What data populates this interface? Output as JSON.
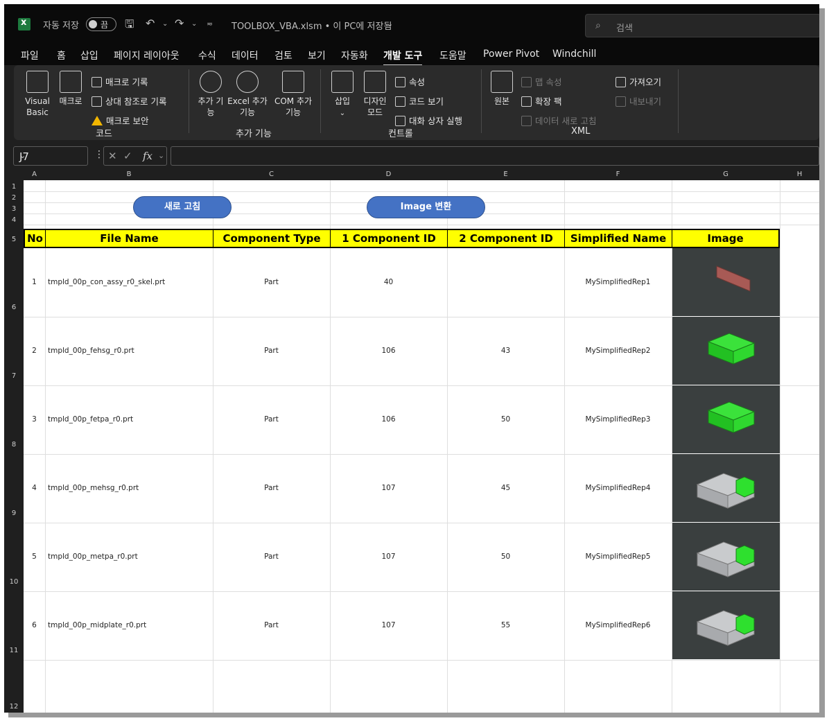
{
  "titlebar": {
    "autosave_label": "자동 저장",
    "autosave_state": "끔",
    "doc_title": "TOOLBOX_VBA.xlsm • 이 PC에 저장됨",
    "search_placeholder": "검색"
  },
  "tabs": [
    "파일",
    "홈",
    "삽입",
    "페이지 레이아웃",
    "수식",
    "데이터",
    "검토",
    "보기",
    "자동화",
    "개발 도구",
    "도움말",
    "Power Pivot",
    "Windchill"
  ],
  "active_tab": "개발 도구",
  "ribbon": {
    "code": {
      "label": "코드",
      "visual_basic": "Visual Basic",
      "macro": "매크로",
      "record_macro": "매크로 기록",
      "relative_ref": "상대 참조로 기록",
      "macro_security": "매크로 보안"
    },
    "addins": {
      "label": "추가 기능",
      "addins_btn": "추가 기능",
      "excel_addins": "Excel 추가 기능",
      "com_addins": "COM 추가 기능"
    },
    "controls": {
      "label": "컨트롤",
      "insert": "삽입",
      "design_mode": "디자인 모드",
      "properties": "속성",
      "view_code": "코드 보기",
      "run_dialog": "대화 상자 실행"
    },
    "xml": {
      "label": "XML",
      "source": "원본",
      "map_properties": "맵 속성",
      "expansion_packs": "확장 팩",
      "refresh_data": "데이터 새로 고침",
      "import": "가져오기",
      "export": "내보내기"
    }
  },
  "formula_bar": {
    "name_box": "J7",
    "fx": "fx",
    "value": ""
  },
  "columns": [
    "A",
    "B",
    "C",
    "D",
    "E",
    "F",
    "G",
    "H"
  ],
  "rows": [
    "1",
    "2",
    "3",
    "4",
    "5",
    "6",
    "7",
    "8",
    "9",
    "10",
    "11",
    "12"
  ],
  "buttons": {
    "refresh": "새로 고침",
    "image_convert": "Image 변환"
  },
  "table": {
    "headers": [
      "No",
      "File Name",
      "Component Type",
      "1 Component ID",
      "2 Component ID",
      "Simplified Name",
      "Image"
    ],
    "rows": [
      {
        "no": "1",
        "file": "tmpld_00p_con_assy_r0_skel.prt",
        "type": "Part",
        "id1": "40",
        "id2": "",
        "name": "MySimplifiedRep1",
        "image": "flat-plate-red"
      },
      {
        "no": "2",
        "file": "tmpld_00p_fehsg_r0.prt",
        "type": "Part",
        "id1": "106",
        "id2": "43",
        "name": "MySimplifiedRep2",
        "image": "box-green"
      },
      {
        "no": "3",
        "file": "tmpld_00p_fetpa_r0.prt",
        "type": "Part",
        "id1": "106",
        "id2": "50",
        "name": "MySimplifiedRep3",
        "image": "box-green"
      },
      {
        "no": "4",
        "file": "tmpld_00p_mehsg_r0.prt",
        "type": "Part",
        "id1": "107",
        "id2": "45",
        "name": "MySimplifiedRep4",
        "image": "assembly-gray-green"
      },
      {
        "no": "5",
        "file": "tmpld_00p_metpa_r0.prt",
        "type": "Part",
        "id1": "107",
        "id2": "50",
        "name": "MySimplifiedRep5",
        "image": "assembly-gray-green"
      },
      {
        "no": "6",
        "file": "tmpld_00p_midplate_r0.prt",
        "type": "Part",
        "id1": "107",
        "id2": "55",
        "name": "MySimplifiedRep6",
        "image": "assembly-gray-green"
      }
    ]
  },
  "colors": {
    "header_fill": "#ffff00",
    "button_fill": "#4472c4",
    "image_bg": "#3a3f3f"
  }
}
